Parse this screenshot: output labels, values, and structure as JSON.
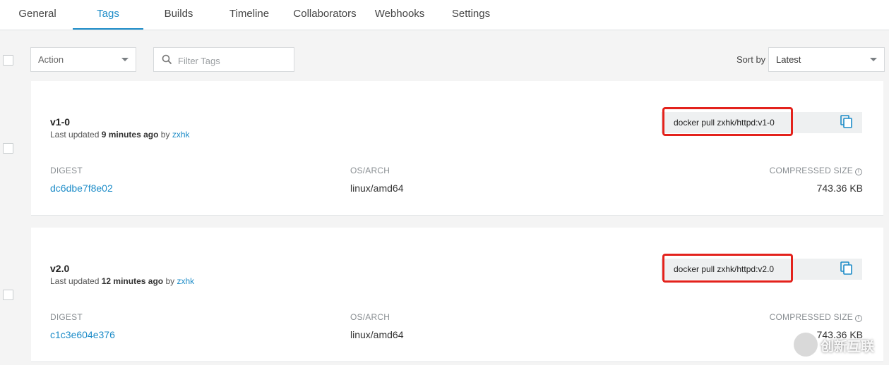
{
  "tabs": [
    {
      "label": "General"
    },
    {
      "label": "Tags"
    },
    {
      "label": "Builds"
    },
    {
      "label": "Timeline"
    },
    {
      "label": "Collaborators"
    },
    {
      "label": "Webhooks"
    },
    {
      "label": "Settings"
    }
  ],
  "active_tab": "Tags",
  "toolbar": {
    "action_label": "Action",
    "filter_placeholder": "Filter Tags",
    "sort_label": "Sort by",
    "sort_value": "Latest"
  },
  "tags": [
    {
      "name": "v1-0",
      "updated_prefix": "Last updated",
      "updated_time": "9 minutes ago",
      "by_text": "by",
      "user": "zxhk",
      "command": "docker pull zxhk/httpd:v1-0",
      "digest_label": "DIGEST",
      "digest": "dc6dbe7f8e02",
      "osarch_label": "OS/ARCH",
      "osarch": "linux/amd64",
      "size_label": "COMPRESSED SIZE",
      "size": "743.36 KB"
    },
    {
      "name": "v2.0",
      "updated_prefix": "Last updated",
      "updated_time": "12 minutes ago",
      "by_text": "by",
      "user": "zxhk",
      "command": "docker pull zxhk/httpd:v2.0",
      "digest_label": "DIGEST",
      "digest": "c1c3e604e376",
      "osarch_label": "OS/ARCH",
      "osarch": "linux/amd64",
      "size_label": "COMPRESSED SIZE",
      "size": "743.36 KB"
    }
  ],
  "watermark": "创新互联",
  "colors": {
    "accent": "#1d8cc8",
    "highlight": "#e3221c"
  }
}
